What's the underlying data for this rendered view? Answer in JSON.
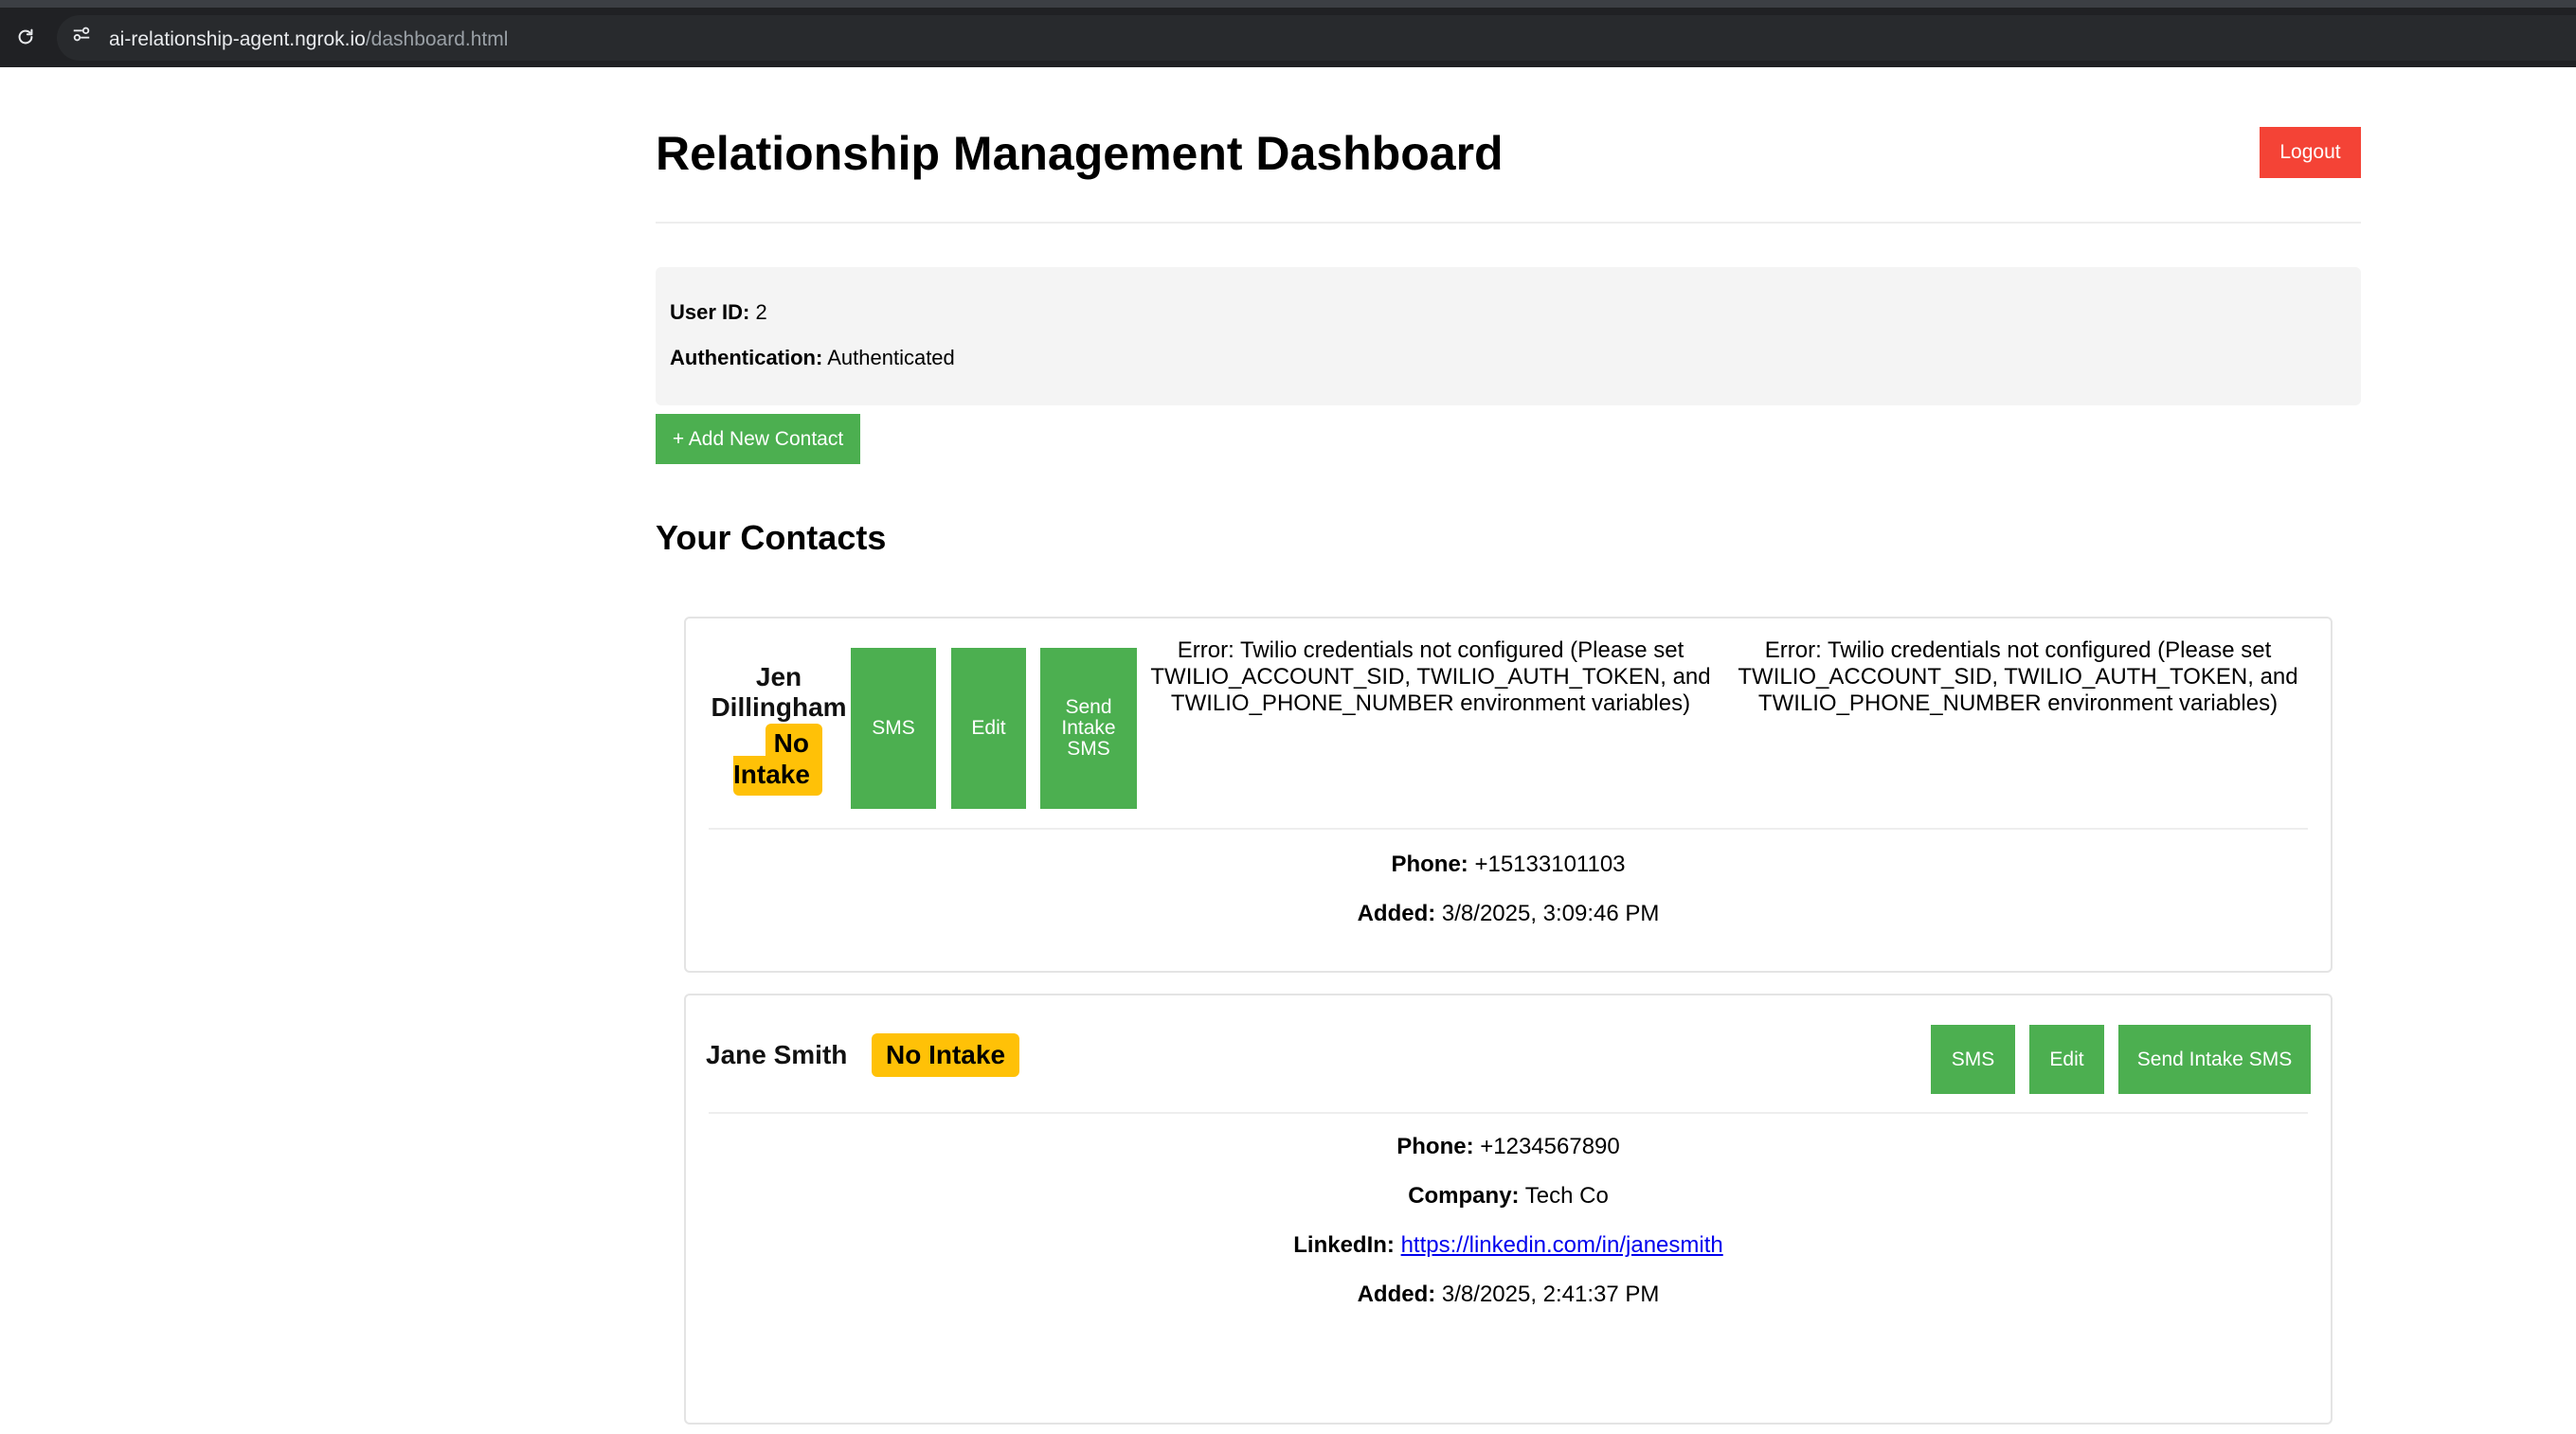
{
  "browser": {
    "url_domain": "ai-relationship-agent.ngrok.io",
    "url_path": "/dashboard.html"
  },
  "header": {
    "title": "Relationship Management Dashboard",
    "logout_label": "Logout"
  },
  "user_info": {
    "user_id_label": "User ID:",
    "user_id_value": "2",
    "auth_label": "Authentication:",
    "auth_value": "Authenticated"
  },
  "add_contact_label": "+ Add New Contact",
  "contacts_section_title": "Your Contacts",
  "contacts": [
    {
      "name": "Jen Dillingham",
      "badge": "No Intake",
      "sms_label": "SMS",
      "edit_label": "Edit",
      "intake_label": "Send Intake SMS",
      "errors": [
        "Error: Twilio credentials not configured (Please set TWILIO_ACCOUNT_SID, TWILIO_AUTH_TOKEN, and TWILIO_PHONE_NUMBER environment variables)",
        "Error: Twilio credentials not configured (Please set TWILIO_ACCOUNT_SID, TWILIO_AUTH_TOKEN, and TWILIO_PHONE_NUMBER environment variables)"
      ],
      "phone_label": "Phone:",
      "phone": "+15133101103",
      "added_label": "Added:",
      "added": "3/8/2025, 3:09:46 PM"
    },
    {
      "name": "Jane Smith",
      "badge": "No Intake",
      "sms_label": "SMS",
      "edit_label": "Edit",
      "intake_label": "Send Intake SMS",
      "phone_label": "Phone:",
      "phone": "+1234567890",
      "company_label": "Company:",
      "company": "Tech Co",
      "linkedin_label": "LinkedIn:",
      "linkedin": "https://linkedin.com/in/janesmith",
      "added_label": "Added:",
      "added": "3/8/2025, 2:41:37 PM"
    }
  ],
  "colors": {
    "primary_green": "#4caf50",
    "logout_red": "#f44336",
    "badge_yellow": "#ffc107",
    "info_panel_bg": "#f4f4f4",
    "browser_bar": "#202124"
  },
  "icons": {
    "reload": "reload-icon",
    "site_info": "site-info-icon"
  }
}
